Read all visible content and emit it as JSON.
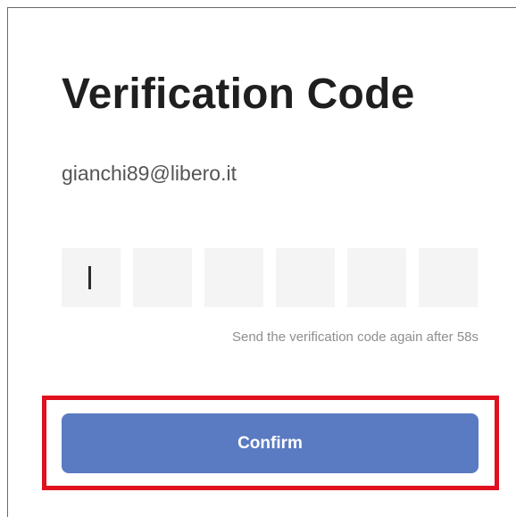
{
  "page": {
    "title": "Verification Code",
    "email": "gianchi89@libero.it"
  },
  "code_input": {
    "digit_count": 6,
    "digits": [
      "",
      "",
      "",
      "",
      "",
      ""
    ],
    "focused_index": 0
  },
  "resend": {
    "text": "Send the verification code again after 58s"
  },
  "confirm": {
    "label": "Confirm"
  },
  "colors": {
    "accent": "#5a7ac2",
    "highlight": "#e0101e"
  }
}
